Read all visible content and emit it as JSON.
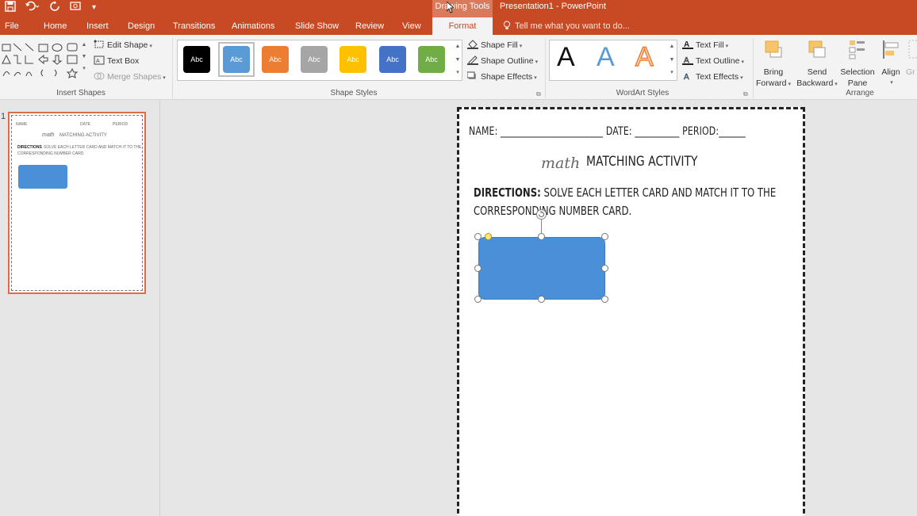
{
  "titlebar": {
    "context_label": "Drawing Tools",
    "app_title": "Presentation1 - PowerPoint"
  },
  "tabs": [
    "File",
    "Home",
    "Insert",
    "Design",
    "Transitions",
    "Animations",
    "Slide Show",
    "Review",
    "View",
    "Format"
  ],
  "active_tab": "Format",
  "tell_me": "Tell me what you want to do...",
  "ribbon": {
    "insert_shapes": {
      "label": "Insert Shapes",
      "edit_shape": "Edit Shape",
      "text_box": "Text Box",
      "merge_shapes": "Merge Shapes"
    },
    "shape_styles": {
      "label": "Shape Styles",
      "swatch_text": "Abc",
      "swatches": [
        "#000000",
        "#5b9bd5",
        "#ed7d31",
        "#a5a5a5",
        "#ffc000",
        "#4472c4",
        "#70ad47"
      ],
      "shape_fill": "Shape Fill",
      "shape_outline": "Shape Outline",
      "shape_effects": "Shape Effects"
    },
    "wordart_styles": {
      "label": "WordArt Styles",
      "letter": "A",
      "text_fill": "Text Fill",
      "text_outline": "Text Outline",
      "text_effects": "Text Effects"
    },
    "arrange": {
      "label": "Arrange",
      "bring_forward_1": "Bring",
      "bring_forward_2": "Forward",
      "send_backward_1": "Send",
      "send_backward_2": "Backward",
      "selection_pane_1": "Selection",
      "selection_pane_2": "Pane",
      "align": "Align",
      "group_partial": "Gr"
    }
  },
  "slides_pane": {
    "slide_number": "1",
    "thumb_name": "NAME",
    "thumb_date": "DATE",
    "thumb_period": "PERIOD",
    "thumb_title_script": "math",
    "thumb_title": "MATCHING ACTIVITY",
    "thumb_dir1_bold": "DIRECTIONS",
    "thumb_dir1": "SOLVE EACH LETTER CARD AND MATCH IT TO THE",
    "thumb_dir2": "CORRESPONDING NUMBER CARD."
  },
  "slide": {
    "name_line": "NAME: _______________________ DATE: __________ PERIOD:______",
    "title_script": "math",
    "title_main": "MATCHING ACTIVITY",
    "directions_bold": "DIRECTIONS:",
    "directions_1": " SOLVE EACH LETTER CARD AND MATCH IT TO THE",
    "directions_2": "CORRESPONDING NUMBER CARD.",
    "shape_color": "#4a90d9"
  },
  "colors": {
    "accent": "#c84a24"
  }
}
